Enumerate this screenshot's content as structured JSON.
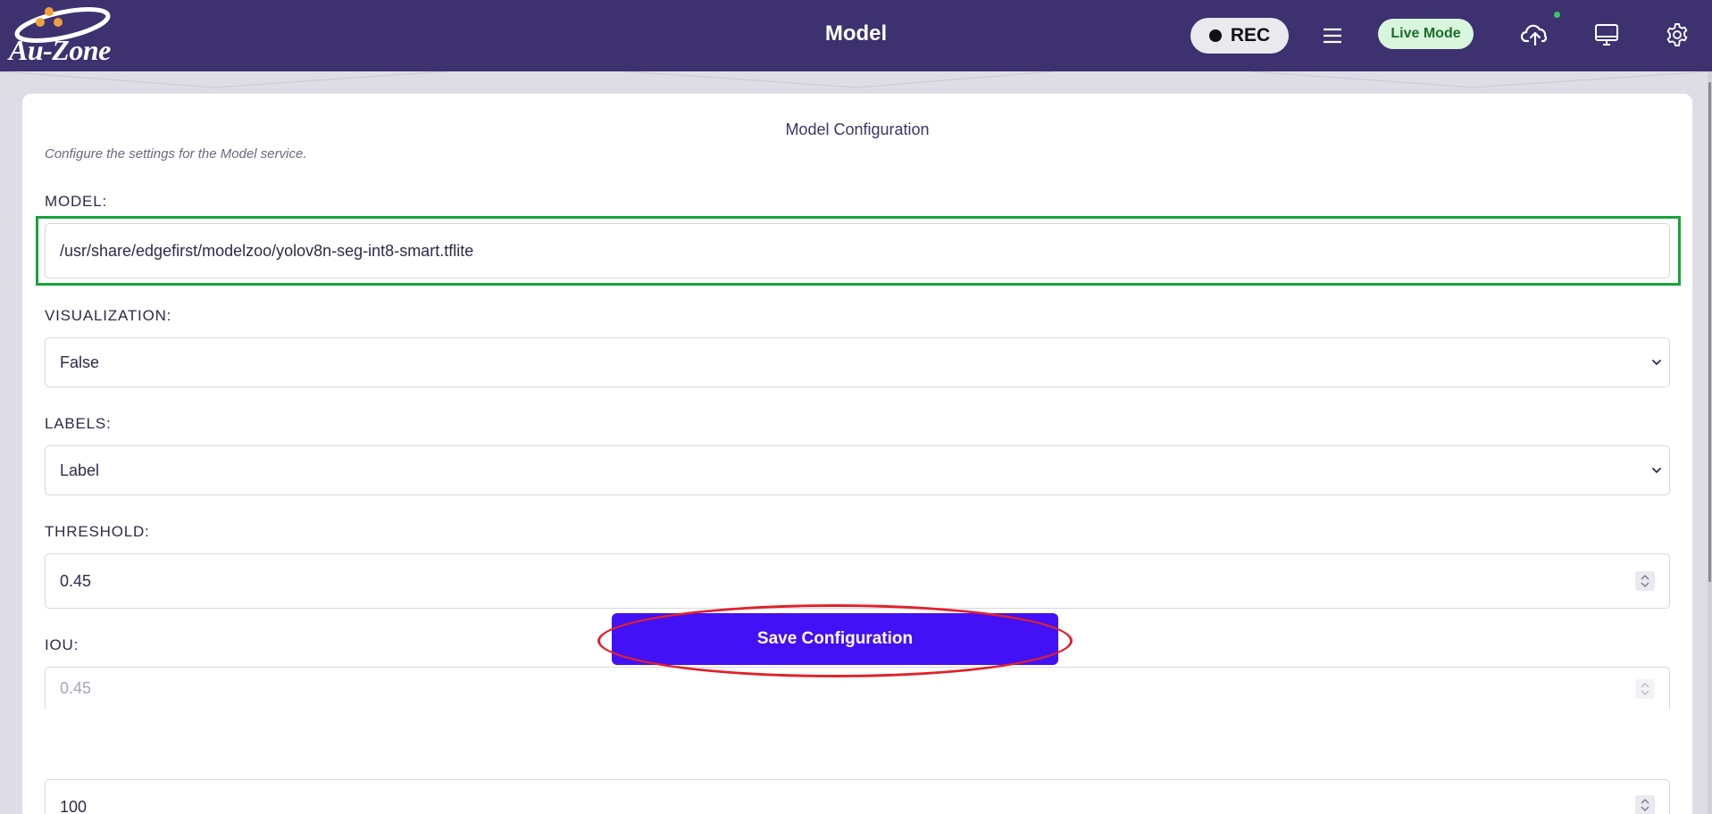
{
  "header": {
    "logo_text": "Au-Zone",
    "title": "Model",
    "rec_label": "REC",
    "live_label": "Live Mode"
  },
  "card": {
    "title": "Model Configuration",
    "description": "Configure the settings for the Model service."
  },
  "fields": {
    "model": {
      "label": "MODEL:",
      "value": "/usr/share/edgefirst/modelzoo/yolov8n-seg-int8-smart.tflite"
    },
    "visualization": {
      "label": "VISUALIZATION:",
      "value": "False"
    },
    "labels": {
      "label": "LABELS:",
      "value": "Label"
    },
    "threshold": {
      "label": "THRESHOLD:",
      "value": "0.45"
    },
    "iou": {
      "label": "IOU:",
      "value": "0.45"
    },
    "max_boxes": {
      "value": "100"
    }
  },
  "save_button": {
    "label": "Save Configuration"
  },
  "colors": {
    "header_bg": "#3d3170",
    "accent": "#4211f5",
    "live_bg": "#d8f6dc",
    "highlight_green": "#19a23a",
    "highlight_red": "#e2202a"
  },
  "icons": [
    "record-dot-icon",
    "menu-icon",
    "cloud-upload-icon",
    "monitor-icon",
    "gear-icon",
    "chevron-down-icon",
    "spinner-icon"
  ]
}
